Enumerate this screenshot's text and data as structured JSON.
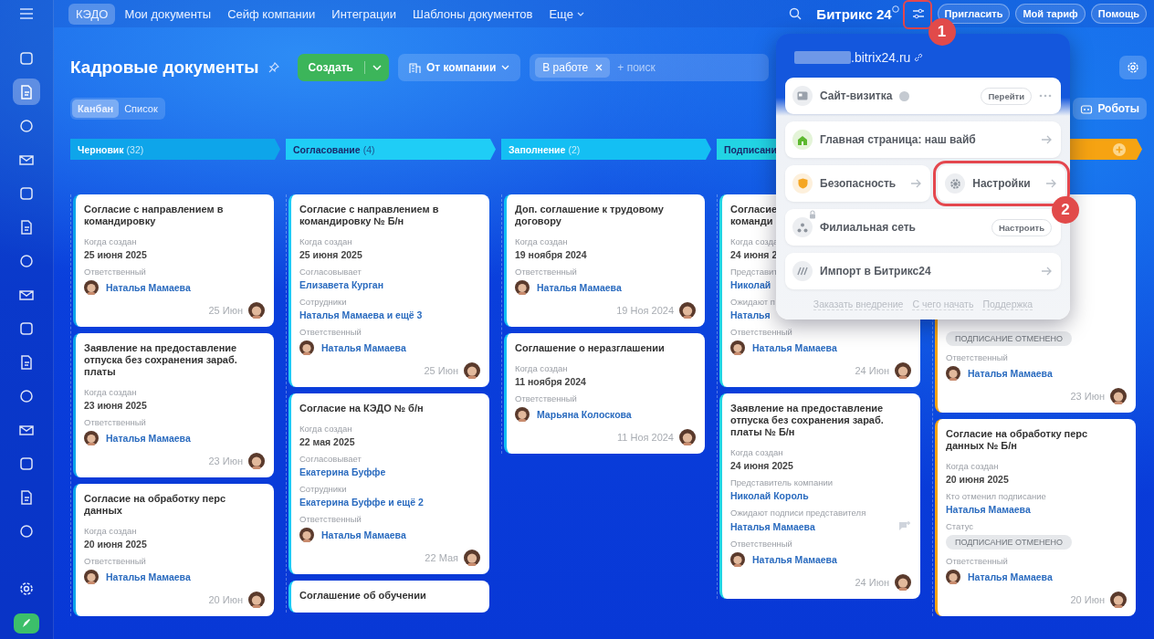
{
  "sidebar": {
    "items": [
      {
        "selected": false
      },
      {
        "selected": true
      },
      {
        "selected": false
      },
      {
        "selected": false
      },
      {
        "selected": false
      },
      {
        "selected": false
      },
      {
        "selected": false
      },
      {
        "selected": false
      },
      {
        "selected": false
      },
      {
        "selected": false
      },
      {
        "selected": false
      },
      {
        "selected": false
      },
      {
        "selected": false
      },
      {
        "selected": false
      },
      {
        "selected": false
      }
    ]
  },
  "top_bar": {
    "tabs": [
      {
        "label": "КЭДО",
        "selected": true
      },
      {
        "label": "Мои документы",
        "selected": false
      },
      {
        "label": "Сейф компании",
        "selected": false
      },
      {
        "label": "Интеграции",
        "selected": false
      },
      {
        "label": "Шаблоны документов",
        "selected": false
      },
      {
        "label": "Еще",
        "selected": false
      }
    ],
    "logo": {
      "name": "Битрикс",
      "suffix": "24"
    },
    "settings_step": "1",
    "buttons": [
      "Пригласить",
      "Мой тариф",
      "Помощь"
    ]
  },
  "header": {
    "title": "Кадровые документы",
    "create_button": "Создать",
    "filter_dropdown": "От компании",
    "search": {
      "chip": "В работе",
      "placeholder": "+ поиск"
    }
  },
  "view_switch": [
    {
      "label": "Канбан",
      "selected": true
    },
    {
      "label": "Список",
      "selected": false
    }
  ],
  "robots_button": "Роботы",
  "columns": [
    {
      "name": "Черновик",
      "count": "(32)",
      "color": "#0ea5ea",
      "add_button": false,
      "cards": [
        {
          "title": "Согласие с направлением в командировку",
          "fields": [
            {
              "label": "Когда создан",
              "value": "25 июня 2025",
              "kind": "text"
            },
            {
              "label": "Ответственный",
              "value": "Наталья Мамаева",
              "kind": "person"
            }
          ],
          "date": "25 Июн"
        },
        {
          "title": "Заявление на предоставление отпуска без сохранения зараб. платы",
          "fields": [
            {
              "label": "Когда создан",
              "value": "23 июня 2025",
              "kind": "text"
            },
            {
              "label": "Ответственный",
              "value": "Наталья Мамаева",
              "kind": "person"
            }
          ],
          "date": "23 Июн"
        },
        {
          "title": "Согласие на обработку перс данных",
          "fields": [
            {
              "label": "Когда создан",
              "value": "20 июня 2025",
              "kind": "text"
            },
            {
              "label": "Ответственный",
              "value": "Наталья Мамаева",
              "kind": "person"
            }
          ],
          "date": "20 Июн"
        }
      ]
    },
    {
      "name": "Согласование",
      "count": "(4)",
      "color": "#1fcdf6",
      "add_button": false,
      "cards": [
        {
          "title": "Согласие с направлением в командировку № Б/н",
          "fields": [
            {
              "label": "Когда создан",
              "value": "25 июня 2025",
              "kind": "text"
            },
            {
              "label": "Согласовывает",
              "value": "Елизавета Курган",
              "kind": "link"
            },
            {
              "label": "Сотрудники",
              "value": "Наталья Мамаева и ещё 3",
              "kind": "link"
            },
            {
              "label": "Ответственный",
              "value": "Наталья Мамаева",
              "kind": "person"
            }
          ],
          "date": "25 Июн"
        },
        {
          "title": "Согласие на КЭДО № б/н",
          "fields": [
            {
              "label": "Когда создан",
              "value": "22 мая 2025",
              "kind": "text"
            },
            {
              "label": "Согласовывает",
              "value": "Екатерина Буффе",
              "kind": "link"
            },
            {
              "label": "Сотрудники",
              "value": "Екатерина Буффе и ещё 2",
              "kind": "link"
            },
            {
              "label": "Ответственный",
              "value": "Наталья Мамаева",
              "kind": "person"
            }
          ],
          "date": "22 Мая"
        },
        {
          "title": "Соглашение об обучении"
        }
      ]
    },
    {
      "name": "Заполнение",
      "count": "(2)",
      "color": "#14bff3",
      "add_button": false,
      "cards": [
        {
          "title": "Доп. соглашение к трудовому договору",
          "fields": [
            {
              "label": "Когда создан",
              "value": "19 ноября 2024",
              "kind": "text"
            },
            {
              "label": "Ответственный",
              "value": "Наталья Мамаева",
              "kind": "person"
            }
          ],
          "date": "19 Ноя 2024"
        },
        {
          "title": "Соглашение о неразглашении",
          "fields": [
            {
              "label": "Когда создан",
              "value": "11 ноября 2024",
              "kind": "text"
            },
            {
              "label": "Ответственный",
              "value": "Марьяна Колоскова",
              "kind": "person"
            }
          ],
          "date": "11 Ноя 2024"
        }
      ]
    },
    {
      "name": "Подписани",
      "color": "#22d4e4",
      "add_button": false,
      "cards": [
        {
          "title": "Согласие\nкоманди",
          "fields": [
            {
              "label": "Когда созда",
              "value": "24 июня 2",
              "kind": "text"
            },
            {
              "label": "Представит",
              "value": "Николай",
              "kind": "link"
            },
            {
              "label": "Ожидают п",
              "value": "Наталья",
              "kind": "link"
            },
            {
              "label": "Ответственный",
              "value": "Наталья Мамаева",
              "kind": "person"
            }
          ],
          "date": "24 Июн"
        },
        {
          "title": "Заявление на предоставление отпуска без сохранения зараб. платы № Б/н",
          "fields": [
            {
              "label": "Когда создан",
              "value": "24 июня 2025",
              "kind": "text"
            },
            {
              "label": "Представитель компании",
              "value": "Николай Король",
              "kind": "link"
            },
            {
              "label": "Ожидают подписи представителя",
              "value": "Наталья Мамаева",
              "kind": "link",
              "has_action": true
            },
            {
              "label": "Ответственный",
              "value": "Наталья Мамаева",
              "kind": "person"
            }
          ],
          "date": "24 Июн"
        }
      ]
    },
    {
      "color": "#f6a312",
      "add_button": true,
      "cards": [
        {
          "fields": [
            {
              "value": "ПОДПИСАНИЕ ОТМЕНЕНО",
              "kind": "badge"
            },
            {
              "label": "Ответственный",
              "value": "Наталья Мамаева",
              "kind": "person"
            }
          ],
          "date": "23 Июн"
        },
        {
          "title": "Согласие на обработку перс данных № Б/н",
          "fields": [
            {
              "label": "Когда создан",
              "value": "20 июня 2025",
              "kind": "text"
            },
            {
              "label": "Кто отменил подписание",
              "value": "Наталья Мамаева",
              "kind": "link"
            },
            {
              "label": "Статус",
              "value": "ПОДПИСАНИЕ ОТМЕНЕНО",
              "kind": "badge"
            },
            {
              "label": "Ответственный",
              "value": "Наталья Мамаева",
              "kind": "person"
            }
          ],
          "date": "20 Июн"
        }
      ]
    }
  ],
  "portal_popup": {
    "domain": ".bitrix24.ru",
    "site_card": {
      "label": "Сайт-визитка",
      "button": "Перейти"
    },
    "home_page": {
      "label": "Главная страница: наш вайб"
    },
    "security": {
      "label": "Безопасность"
    },
    "settings": {
      "label": "Настройки",
      "highlighted": true,
      "step": "2"
    },
    "branch_network": {
      "label": "Филиальная сеть",
      "button": "Настроить",
      "locked": true
    },
    "import": {
      "label": "Импорт в Битрикс24"
    },
    "footer_links": [
      "Заказать внедрение",
      "С чего начать",
      "Поддержка"
    ]
  }
}
